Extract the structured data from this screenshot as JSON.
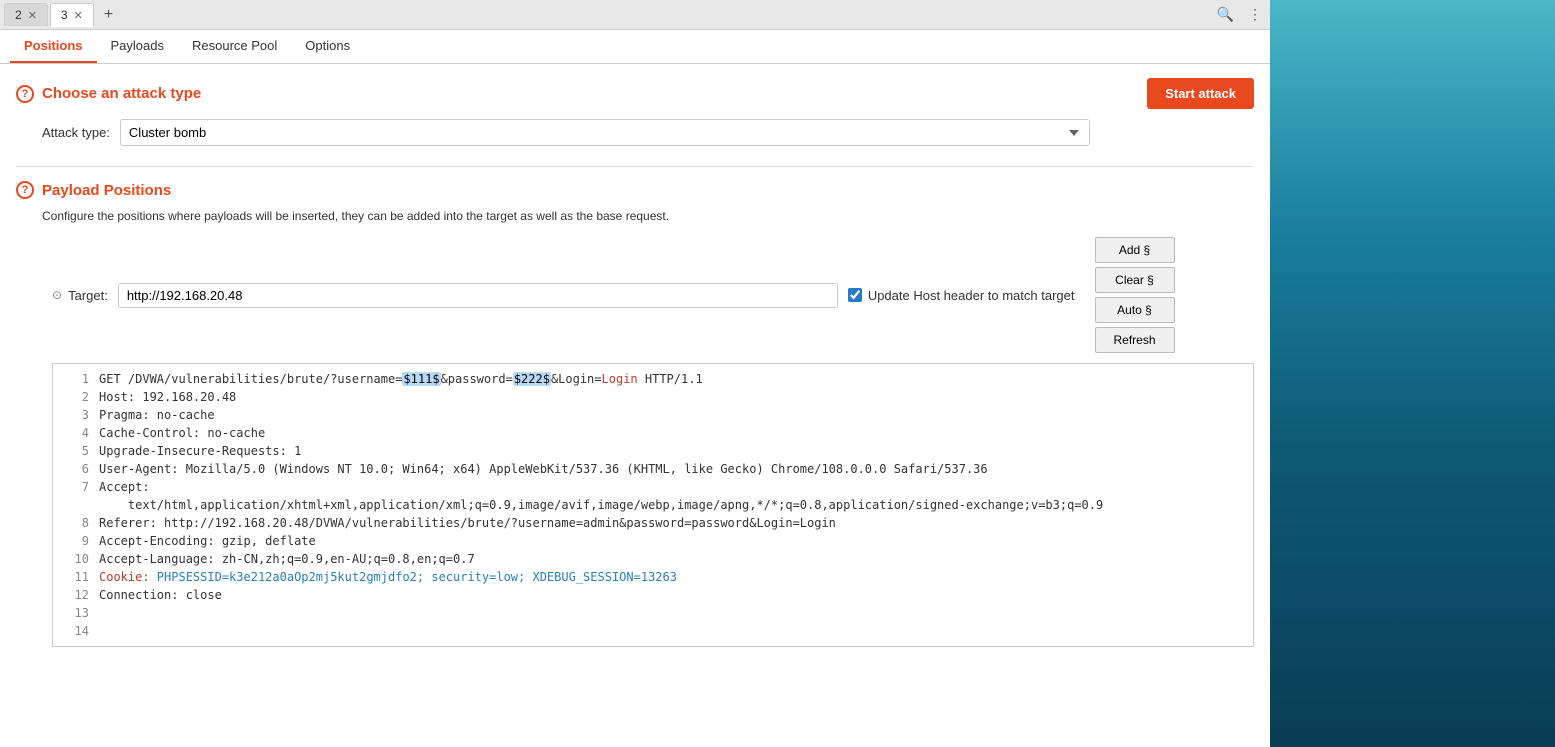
{
  "tabs": [
    {
      "id": "2",
      "label": "2",
      "active": false
    },
    {
      "id": "3",
      "label": "3",
      "active": true
    }
  ],
  "tab_plus": "+",
  "nav": {
    "items": [
      {
        "id": "positions",
        "label": "Positions",
        "active": true
      },
      {
        "id": "payloads",
        "label": "Payloads",
        "active": false
      },
      {
        "id": "resource_pool",
        "label": "Resource Pool",
        "active": false
      },
      {
        "id": "options",
        "label": "Options",
        "active": false
      }
    ]
  },
  "attack": {
    "choose_label": "Choose an attack type",
    "start_label": "Start attack",
    "type_label": "Attack type:",
    "type_value": "Cluster bomb"
  },
  "payload_positions": {
    "title": "Payload Positions",
    "description": "Configure the positions where payloads will be inserted, they can be added into the target as well as the base request.",
    "target_label": "Target:",
    "target_value": "http://192.168.20.48",
    "update_host_label": "Update Host header to match target",
    "buttons": {
      "add": "Add §",
      "clear": "Clear §",
      "auto": "Auto §",
      "refresh": "Refresh"
    }
  },
  "request_lines": [
    {
      "num": "1",
      "parts": [
        {
          "text": "GET /DVWA/vulnerabilities/brute/?username=",
          "type": "plain"
        },
        {
          "text": "$111$",
          "type": "marker"
        },
        {
          "text": "&password=",
          "type": "plain"
        },
        {
          "text": "$222$",
          "type": "marker"
        },
        {
          "text": "&Login=",
          "type": "plain"
        },
        {
          "text": "Login",
          "type": "highlight-red"
        },
        {
          "text": " HTTP/1.1",
          "type": "plain"
        }
      ]
    },
    {
      "num": "2",
      "parts": [
        {
          "text": "Host: 192.168.20.48",
          "type": "plain"
        }
      ]
    },
    {
      "num": "3",
      "parts": [
        {
          "text": "Pragma: no-cache",
          "type": "plain"
        }
      ]
    },
    {
      "num": "4",
      "parts": [
        {
          "text": "Cache-Control: no-cache",
          "type": "plain"
        }
      ]
    },
    {
      "num": "5",
      "parts": [
        {
          "text": "Upgrade-Insecure-Requests: 1",
          "type": "plain"
        }
      ]
    },
    {
      "num": "6",
      "parts": [
        {
          "text": "User-Agent: Mozilla/5.0 (Windows NT 10.0; Win64; x64) AppleWebKit/537.36 (KHTML, like Gecko) Chrome/108.0.0.0 Safari/537.36",
          "type": "plain"
        }
      ]
    },
    {
      "num": "7",
      "parts": [
        {
          "text": "Accept:",
          "type": "plain"
        }
      ]
    },
    {
      "num": "",
      "parts": [
        {
          "text": "    text/html,application/xhtml+xml,application/xml;q=0.9,image/avif,image/webp,image/apng,*/*;q=0.8,application/signed-exchange;v=b3;q=0.9",
          "type": "plain"
        }
      ]
    },
    {
      "num": "8",
      "parts": [
        {
          "text": "Referer: http://192.168.20.48/DVWA/vulnerabilities/brute/?username=admin&password=password&Login=Login",
          "type": "plain"
        }
      ]
    },
    {
      "num": "9",
      "parts": [
        {
          "text": "Accept-Encoding: gzip, deflate",
          "type": "plain"
        }
      ]
    },
    {
      "num": "10",
      "parts": [
        {
          "text": "Accept-Language: zh-CN,zh;q=0.9,en-AU;q=0.8,en;q=0.7",
          "type": "plain"
        }
      ]
    },
    {
      "num": "11",
      "parts": [
        {
          "text": "Cookie: PHPSESSID=k3e212a0aOp2mj5kut2gmjdfo2; security=low; XDEBUG_SESSION=13263",
          "type": "cookie"
        }
      ]
    },
    {
      "num": "12",
      "parts": [
        {
          "text": "Connection: close",
          "type": "plain"
        }
      ]
    },
    {
      "num": "13",
      "parts": [
        {
          "text": "",
          "type": "plain"
        }
      ]
    },
    {
      "num": "14",
      "parts": [
        {
          "text": "",
          "type": "plain"
        }
      ]
    }
  ]
}
